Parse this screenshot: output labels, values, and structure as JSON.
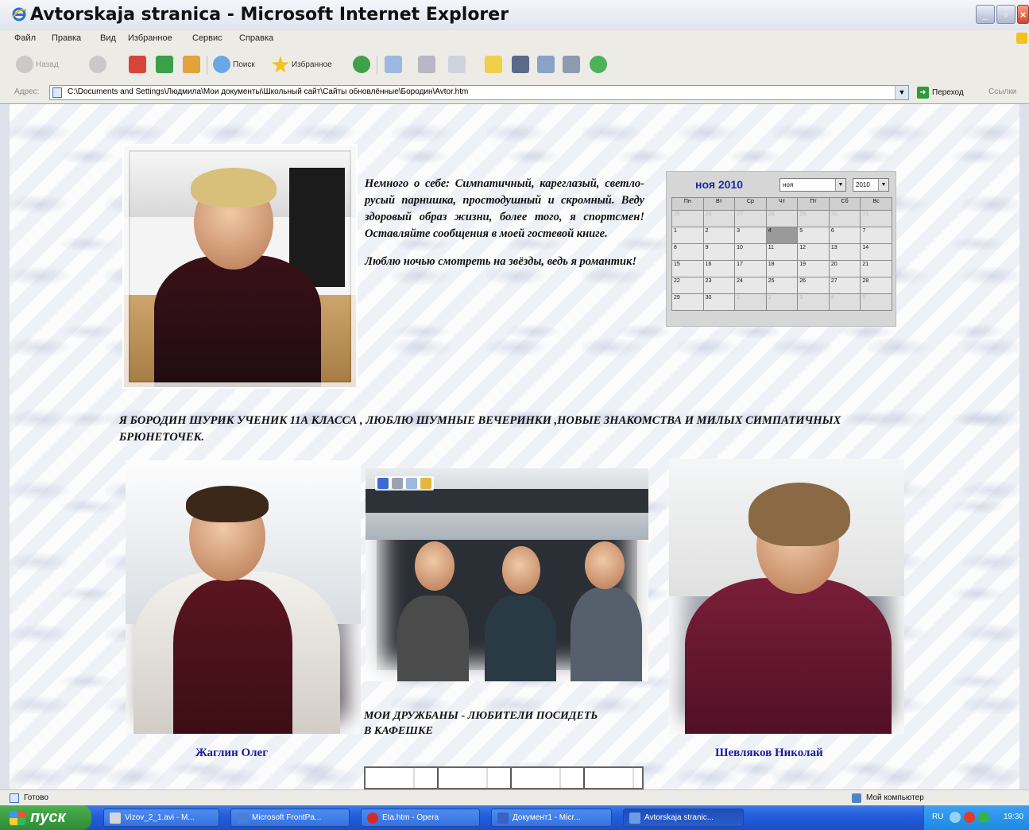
{
  "window": {
    "title": "Avtorskaja stranica - Microsoft Internet Explorer"
  },
  "menu": {
    "items": [
      "Файл",
      "Правка",
      "Вид",
      "Избранное",
      "Сервис",
      "Справка"
    ]
  },
  "toolbar": {
    "back_label": "Назад",
    "search_label": "Поиск",
    "favorites_label": "Избранное"
  },
  "address": {
    "label": "Адрес:",
    "value": "C:\\Documents and Settings\\Людмила\\Мои документы\\Школьный сайт\\Сайты обновлённые\\Бородин\\Avtor.htm",
    "go_label": "Переход",
    "links_label": "Ссылки"
  },
  "page": {
    "about_paragraphs": [
      "Немного о себе: Симпатичный, кареглазый, светло-русый парнишка, простодушный и скромный. Веду здоровый образ жизни, более того, я спортсмен! Оставляйте сообщения в моей гостевой книге.",
      "Люблю ночью смотреть на звёзды, ведь я романтик!"
    ],
    "intro": "Я Бородин Шурик ученик 11А класса , люблю шумные вечеринки ,новые знакомства и милых симпатичных брюнеточек.",
    "friends_caption": "Мои дружбаны - любители посидеть в кафешке",
    "name_left": "Жаглин Олег",
    "name_right": "Шевляков Николай"
  },
  "calendar": {
    "title": "ноя 2010",
    "month_select": "ноя",
    "year_select": "2010",
    "weekdays": [
      "Пн",
      "Вт",
      "Ср",
      "Чт",
      "Пт",
      "Сб",
      "Вс"
    ],
    "weeks": [
      [
        "25",
        "26",
        "27",
        "28",
        "29",
        "30",
        "31"
      ],
      [
        "1",
        "2",
        "3",
        "4",
        "5",
        "6",
        "7"
      ],
      [
        "8",
        "9",
        "10",
        "11",
        "12",
        "13",
        "14"
      ],
      [
        "15",
        "16",
        "17",
        "18",
        "19",
        "20",
        "21"
      ],
      [
        "22",
        "23",
        "24",
        "25",
        "26",
        "27",
        "28"
      ],
      [
        "29",
        "30",
        "1",
        "2",
        "3",
        "4",
        "5"
      ]
    ],
    "today": "4"
  },
  "status": {
    "text": "Готово",
    "zone": "Мой компьютер"
  },
  "taskbar": {
    "start_label": "пуск",
    "tasks": [
      "Vizov_2_1.avi - M...",
      "Microsoft FrontPa...",
      "Eta.htm - Opera",
      "Документ1 - Micr...",
      "Avtorskaja stranic..."
    ],
    "tray_lang": "RU",
    "clock": "19:30"
  }
}
